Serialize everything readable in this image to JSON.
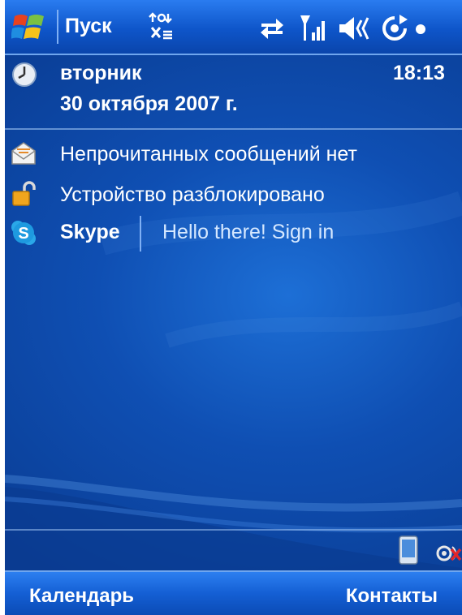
{
  "titlebar": {
    "start_label": "Пуск"
  },
  "today": {
    "day": "вторник",
    "date": "30 октября 2007 г.",
    "time": "18:13"
  },
  "rows": {
    "messages": "Непрочитанных сообщений нет",
    "device_lock": "Устройство разблокировано",
    "skype_name": "Skype",
    "skype_status": "Hello there! Sign in"
  },
  "softkeys": {
    "left": "Календарь",
    "right": "Контакты"
  },
  "colors": {
    "background": "#0f4fb3",
    "bar": "#145fd4",
    "text": "#ffffff"
  },
  "icons": [
    "windows-flag-icon",
    "notification-icon",
    "connectivity-icon",
    "signal-icon",
    "volume-icon",
    "sync-icon",
    "clock-icon",
    "envelope-icon",
    "padlock-icon",
    "skype-icon",
    "device-icon",
    "bluetooth-off-icon"
  ]
}
